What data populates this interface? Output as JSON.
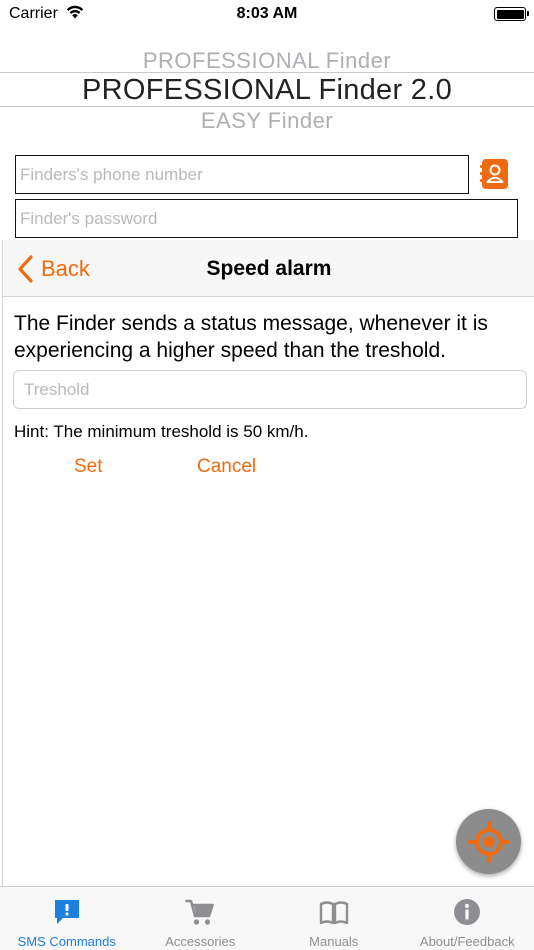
{
  "status_bar": {
    "carrier": "Carrier",
    "time": "8:03 AM"
  },
  "picker": {
    "items": [
      "PROFESSIONAL Finder",
      "PROFESSIONAL Finder 2.0",
      "EASY Finder"
    ],
    "selected_index": 1
  },
  "inputs": {
    "phone_placeholder": "Finders's phone number",
    "password_placeholder": "Finder's password"
  },
  "sheet": {
    "back_label": "Back",
    "title": "Speed alarm",
    "description": "The Finder sends a status message, whenever it is experiencing a higher speed than the treshold.",
    "threshold_placeholder": "Treshold",
    "hint": "Hint: The minimum treshold is 50 km/h.",
    "set_label": "Set",
    "cancel_label": "Cancel"
  },
  "tabs": [
    {
      "label": "SMS Commands",
      "icon": "message-alert-icon",
      "active": true
    },
    {
      "label": "Accessories",
      "icon": "cart-icon",
      "active": false
    },
    {
      "label": "Manuals",
      "icon": "book-icon",
      "active": false
    },
    {
      "label": "About/Feedback",
      "icon": "info-icon",
      "active": false
    }
  ],
  "colors": {
    "accent": "#f06a0f",
    "tab_active": "#1d7fe0",
    "tab_inactive": "#8e8e93",
    "fab": "#8c8c8c"
  }
}
